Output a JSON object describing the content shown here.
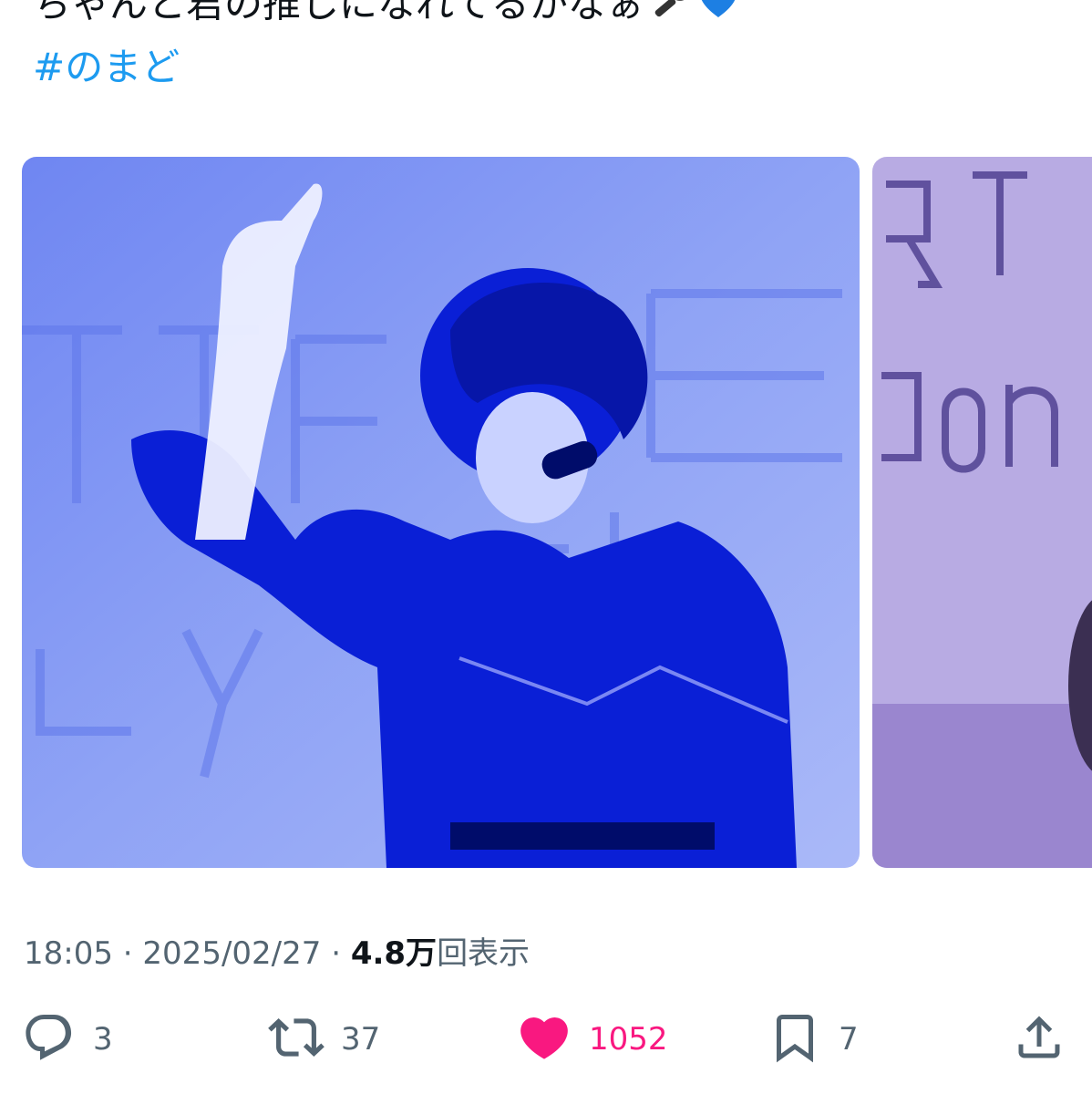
{
  "tweet": {
    "text": "ちゃんと君の推しになれてるかなぁ",
    "emoji": [
      "microphone-emoji",
      "blue-heart-emoji"
    ],
    "hashtag": "#のまど"
  },
  "media": {
    "main_photo_text": "",
    "main_icon": "concert-photo",
    "next_icon": "concert-photo-partial"
  },
  "meta": {
    "time": "18:05",
    "separator1": " · ",
    "date": "2025/02/27",
    "separator2": " · ",
    "views_count": "4.8万",
    "views_label": "回表示"
  },
  "actions": {
    "reply": {
      "icon": "reply-icon",
      "count": "3"
    },
    "retweet": {
      "icon": "retweet-icon",
      "count": "37"
    },
    "like": {
      "icon": "heart-icon",
      "count": "1052",
      "active": true,
      "color": "#f91880"
    },
    "bookmark": {
      "icon": "bookmark-icon",
      "count": "7"
    },
    "share": {
      "icon": "share-icon"
    }
  },
  "colors": {
    "link": "#1d9bf0",
    "secondary_text": "#536471",
    "like": "#f91880"
  }
}
